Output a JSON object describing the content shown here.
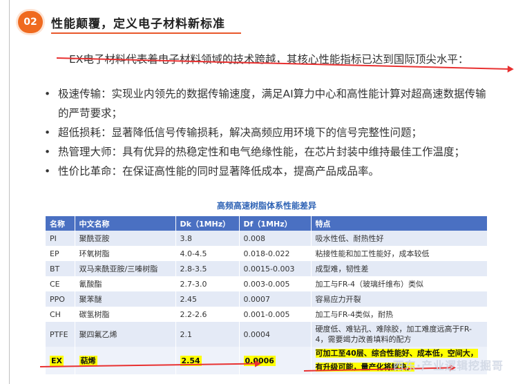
{
  "section": {
    "number": "02",
    "title": "性能颠覆，定义电子材料新标准"
  },
  "intro": "EX电子材料代表着电子材料领域的技术跨越，其核心性能指标已达到国际顶尖水平：",
  "bullets": [
    {
      "marker": "•",
      "text": "极速传输：实现业内领先的数据传输速度，满足AI算力中心和高性能计算对超高速数据传输的严苛要求；"
    },
    {
      "marker": "•",
      "text": "超低损耗：显著降低信号传输损耗，解决高频应用环境下的信号完整性问题；"
    },
    {
      "marker": "•",
      "text": "热管理大师：具有优异的热稳定性和电气绝缘性能，在芯片封装中维持最佳工作温度；"
    },
    {
      "marker": "•",
      "text": "性价比革命：在保证高性能的同时显著降低成本，提高产品成品率。"
    }
  ],
  "table": {
    "title": "高频高速树脂体系性能差异",
    "headers": [
      "名称",
      "中文名称",
      "Dk（1MHz）",
      "Df（1MHz）",
      "特点"
    ],
    "rows": [
      {
        "name": "PI",
        "cn": "聚酰亚胺",
        "dk": "3.8",
        "df": "0.008",
        "feature": "吸水性低、耐热性好"
      },
      {
        "name": "EP",
        "cn": "环氧树脂",
        "dk": "4.0-4.5",
        "df": "0.018-0.022",
        "feature": "粘接性能和加工性能好，成本较低"
      },
      {
        "name": "BT",
        "cn": "双马来酰亚胺/三嗪树脂",
        "dk": "2.8-3.5",
        "df": "0.0015-0.003",
        "feature": "成型难，韧性差"
      },
      {
        "name": "CE",
        "cn": "氰酸酯",
        "dk": "2.7-3.0",
        "df": "0.003-0.005",
        "feature": "加工与FR-4（玻璃纤维布）类似"
      },
      {
        "name": "PPO",
        "cn": "聚苯醚",
        "dk": "2.45",
        "df": "0.0007",
        "feature": "容易应力开裂"
      },
      {
        "name": "CH",
        "cn": "碳氢树脂",
        "dk": "2.2-2.6",
        "df": "0.001-0.005",
        "feature": "加工与FR-4类似，耐热"
      },
      {
        "name": "PTFE",
        "cn": "聚四氟乙烯",
        "dk": "2.1",
        "df": "0.0004",
        "feature": "硬度低、难钻孔、难除胶，加工难度远高于FR-4，需要竭力改善填料的配方"
      },
      {
        "name": "EX",
        "cn": "萜烯",
        "dk": "2.54",
        "df": "0.0006",
        "feature": "可加工至40层、综合性能好、成本低，空间大，有升级可能，量产化将解决。"
      }
    ]
  },
  "watermark": "西东·产业逻辑挖掘哥",
  "colors": {
    "accent": "#ef6a1f",
    "table_header": "#4a70c2",
    "highlight": "#ffff00",
    "arrow": "#e83030"
  }
}
